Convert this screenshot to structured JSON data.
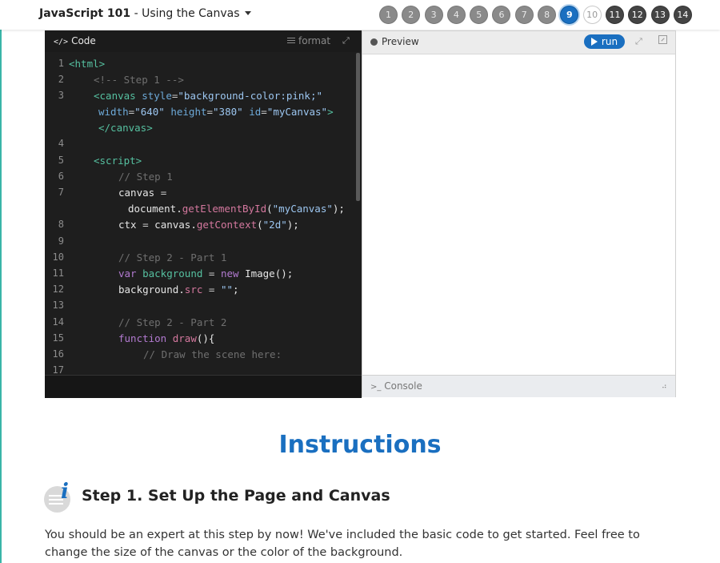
{
  "header": {
    "title_bold": "JavaScript 101",
    "title_rest": " - Using the Canvas",
    "steps": [
      {
        "label": "1",
        "state": "done"
      },
      {
        "label": "2",
        "state": "done"
      },
      {
        "label": "3",
        "state": "done"
      },
      {
        "label": "4",
        "state": "done"
      },
      {
        "label": "5",
        "state": "done"
      },
      {
        "label": "6",
        "state": "done"
      },
      {
        "label": "7",
        "state": "done"
      },
      {
        "label": "8",
        "state": "done"
      },
      {
        "label": "9",
        "state": "current"
      },
      {
        "label": "10",
        "state": "next"
      },
      {
        "label": "11",
        "state": "future"
      },
      {
        "label": "12",
        "state": "future"
      },
      {
        "label": "13",
        "state": "future"
      },
      {
        "label": "14",
        "state": "future"
      }
    ]
  },
  "code_panel": {
    "title": "Code",
    "title_icon": "</>",
    "format_label": "format",
    "line_numbers": [
      "1",
      "2",
      "3",
      "4",
      "5",
      "6",
      "7",
      "8",
      "9",
      "10",
      "11",
      "12",
      "13",
      "14",
      "15",
      "16",
      "17"
    ]
  },
  "preview": {
    "title": "Preview",
    "run_label": "run",
    "console_label": "Console",
    "console_icon": ">_"
  },
  "instructions": {
    "heading": "Instructions",
    "step_title": "Step 1. Set Up the Page and Canvas",
    "text": "You should be an expert at this step by now! We've included the basic code to get started. Feel free to change the size of the canvas or the color of the background."
  },
  "colors": {
    "accent": "#1a6fc0",
    "editor_bg": "#1e1e1e",
    "left_rule": "#39b5a8"
  }
}
